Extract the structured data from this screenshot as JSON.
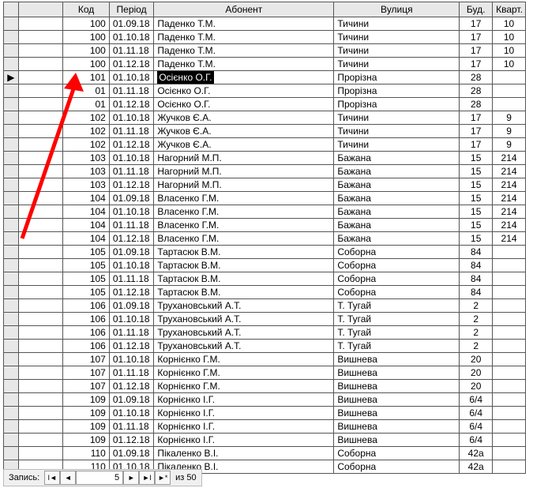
{
  "headers": {
    "code": "Код",
    "period": "Період",
    "abonent": "Абонент",
    "street": "Вулиця",
    "build": "Буд.",
    "apt": "Кварт."
  },
  "selected_row_index": 4,
  "rows": [
    {
      "code": "100",
      "period": "01.09.18",
      "abon": "Паденко Т.М.",
      "street": "Тичини",
      "bud": "17",
      "kv": "10"
    },
    {
      "code": "100",
      "period": "01.10.18",
      "abon": "Паденко Т.М.",
      "street": "Тичини",
      "bud": "17",
      "kv": "10"
    },
    {
      "code": "100",
      "period": "01.11.18",
      "abon": "Паденко Т.М.",
      "street": "Тичини",
      "bud": "17",
      "kv": "10"
    },
    {
      "code": "100",
      "period": "01.12.18",
      "abon": "Паденко Т.М.",
      "street": "Тичини",
      "bud": "17",
      "kv": "10"
    },
    {
      "code": "101",
      "period": "01.10.18",
      "abon": "Осієнко О.Г.",
      "street": "Прорізна",
      "bud": "28",
      "kv": ""
    },
    {
      "code": "01",
      "period": "01.11.18",
      "abon": "Осієнко О.Г.",
      "street": "Прорізна",
      "bud": "28",
      "kv": ""
    },
    {
      "code": "01",
      "period": "01.12.18",
      "abon": "Осієнко О.Г.",
      "street": "Прорізна",
      "bud": "28",
      "kv": ""
    },
    {
      "code": "102",
      "period": "01.10.18",
      "abon": "Жучков Є.А.",
      "street": "Тичини",
      "bud": "17",
      "kv": "9"
    },
    {
      "code": "102",
      "period": "01.11.18",
      "abon": "Жучков Є.А.",
      "street": "Тичини",
      "bud": "17",
      "kv": "9"
    },
    {
      "code": "102",
      "period": "01.12.18",
      "abon": "Жучков Є.А.",
      "street": "Тичини",
      "bud": "17",
      "kv": "9"
    },
    {
      "code": "103",
      "period": "01.10.18",
      "abon": "Нагорний М.П.",
      "street": "Бажана",
      "bud": "15",
      "kv": "214"
    },
    {
      "code": "103",
      "period": "01.11.18",
      "abon": "Нагорний М.П.",
      "street": "Бажана",
      "bud": "15",
      "kv": "214"
    },
    {
      "code": "103",
      "period": "01.12.18",
      "abon": "Нагорний М.П.",
      "street": "Бажана",
      "bud": "15",
      "kv": "214"
    },
    {
      "code": "104",
      "period": "01.09.18",
      "abon": "Власенко Г.М.",
      "street": "Бажана",
      "bud": "15",
      "kv": "214"
    },
    {
      "code": "104",
      "period": "01.10.18",
      "abon": "Власенко Г.М.",
      "street": "Бажана",
      "bud": "15",
      "kv": "214"
    },
    {
      "code": "104",
      "period": "01.11.18",
      "abon": "Власенко Г.М.",
      "street": "Бажана",
      "bud": "15",
      "kv": "214"
    },
    {
      "code": "104",
      "period": "01.12.18",
      "abon": "Власенко Г.М.",
      "street": "Бажана",
      "bud": "15",
      "kv": "214"
    },
    {
      "code": "105",
      "period": "01.09.18",
      "abon": "Тартасюк В.М.",
      "street": "Соборна",
      "bud": "84",
      "kv": ""
    },
    {
      "code": "105",
      "period": "01.10.18",
      "abon": "Тартасюк В.М.",
      "street": "Соборна",
      "bud": "84",
      "kv": ""
    },
    {
      "code": "105",
      "period": "01.11.18",
      "abon": "Тартасюк В.М.",
      "street": "Соборна",
      "bud": "84",
      "kv": ""
    },
    {
      "code": "105",
      "period": "01.12.18",
      "abon": "Тартасюк В.М.",
      "street": "Соборна",
      "bud": "84",
      "kv": ""
    },
    {
      "code": "106",
      "period": "01.09.18",
      "abon": "Трухановський А.Т.",
      "street": "Т. Тугай",
      "bud": "2",
      "kv": ""
    },
    {
      "code": "106",
      "period": "01.10.18",
      "abon": "Трухановський А.Т.",
      "street": "Т. Тугай",
      "bud": "2",
      "kv": ""
    },
    {
      "code": "106",
      "period": "01.11.18",
      "abon": "Трухановський А.Т.",
      "street": "Т. Тугай",
      "bud": "2",
      "kv": ""
    },
    {
      "code": "106",
      "period": "01.12.18",
      "abon": "Трухановський А.Т.",
      "street": "Т. Тугай",
      "bud": "2",
      "kv": ""
    },
    {
      "code": "107",
      "period": "01.10.18",
      "abon": "Корнієнко Г.М.",
      "street": "Вишнева",
      "bud": "20",
      "kv": ""
    },
    {
      "code": "107",
      "period": "01.11.18",
      "abon": "Корнієнко Г.М.",
      "street": "Вишнева",
      "bud": "20",
      "kv": ""
    },
    {
      "code": "107",
      "period": "01.12.18",
      "abon": "Корнієнко Г.М.",
      "street": "Вишнева",
      "bud": "20",
      "kv": ""
    },
    {
      "code": "109",
      "period": "01.09.18",
      "abon": "Корнієнко І.Г.",
      "street": "Вишнева",
      "bud": "6/4",
      "kv": ""
    },
    {
      "code": "109",
      "period": "01.10.18",
      "abon": "Корнієнко І.Г.",
      "street": "Вишнева",
      "bud": "6/4",
      "kv": ""
    },
    {
      "code": "109",
      "period": "01.11.18",
      "abon": "Корнієнко І.Г.",
      "street": "Вишнева",
      "bud": "6/4",
      "kv": ""
    },
    {
      "code": "109",
      "period": "01.12.18",
      "abon": "Корнієнко І.Г.",
      "street": "Вишнева",
      "bud": "6/4",
      "kv": ""
    },
    {
      "code": "110",
      "period": "01.09.18",
      "abon": "Пікаленко В.І.",
      "street": "Соборна",
      "bud": "42а",
      "kv": ""
    },
    {
      "code": "110",
      "period": "01.10.18",
      "abon": "Пікаленко В.І.",
      "street": "Соборна",
      "bud": "42а",
      "kv": ""
    }
  ],
  "nav": {
    "label": "Запись:",
    "current": "5",
    "of_label": "из",
    "total": "50"
  }
}
